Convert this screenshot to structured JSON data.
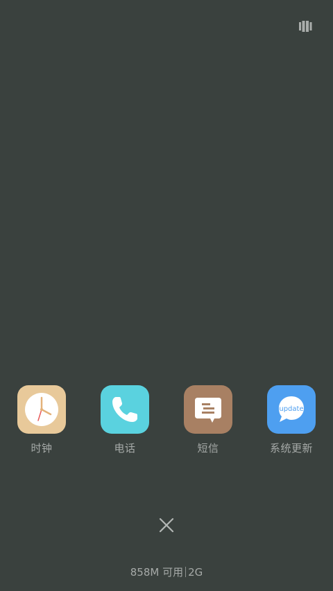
{
  "top_bar": {
    "icon": "task-manager-icon"
  },
  "recent_apps": [
    {
      "label": "时钟",
      "icon": "clock-icon",
      "color": "#e8c99a"
    },
    {
      "label": "电话",
      "icon": "phone-icon",
      "color": "#5ad2df"
    },
    {
      "label": "短信",
      "icon": "message-icon",
      "color": "#a88063"
    },
    {
      "label": "系统更新",
      "icon": "update-icon",
      "color": "#4e9ff0",
      "badge_text": "update"
    }
  ],
  "close_button": {
    "icon": "close-icon"
  },
  "memory": {
    "available": "858M 可用",
    "total": "2G"
  }
}
